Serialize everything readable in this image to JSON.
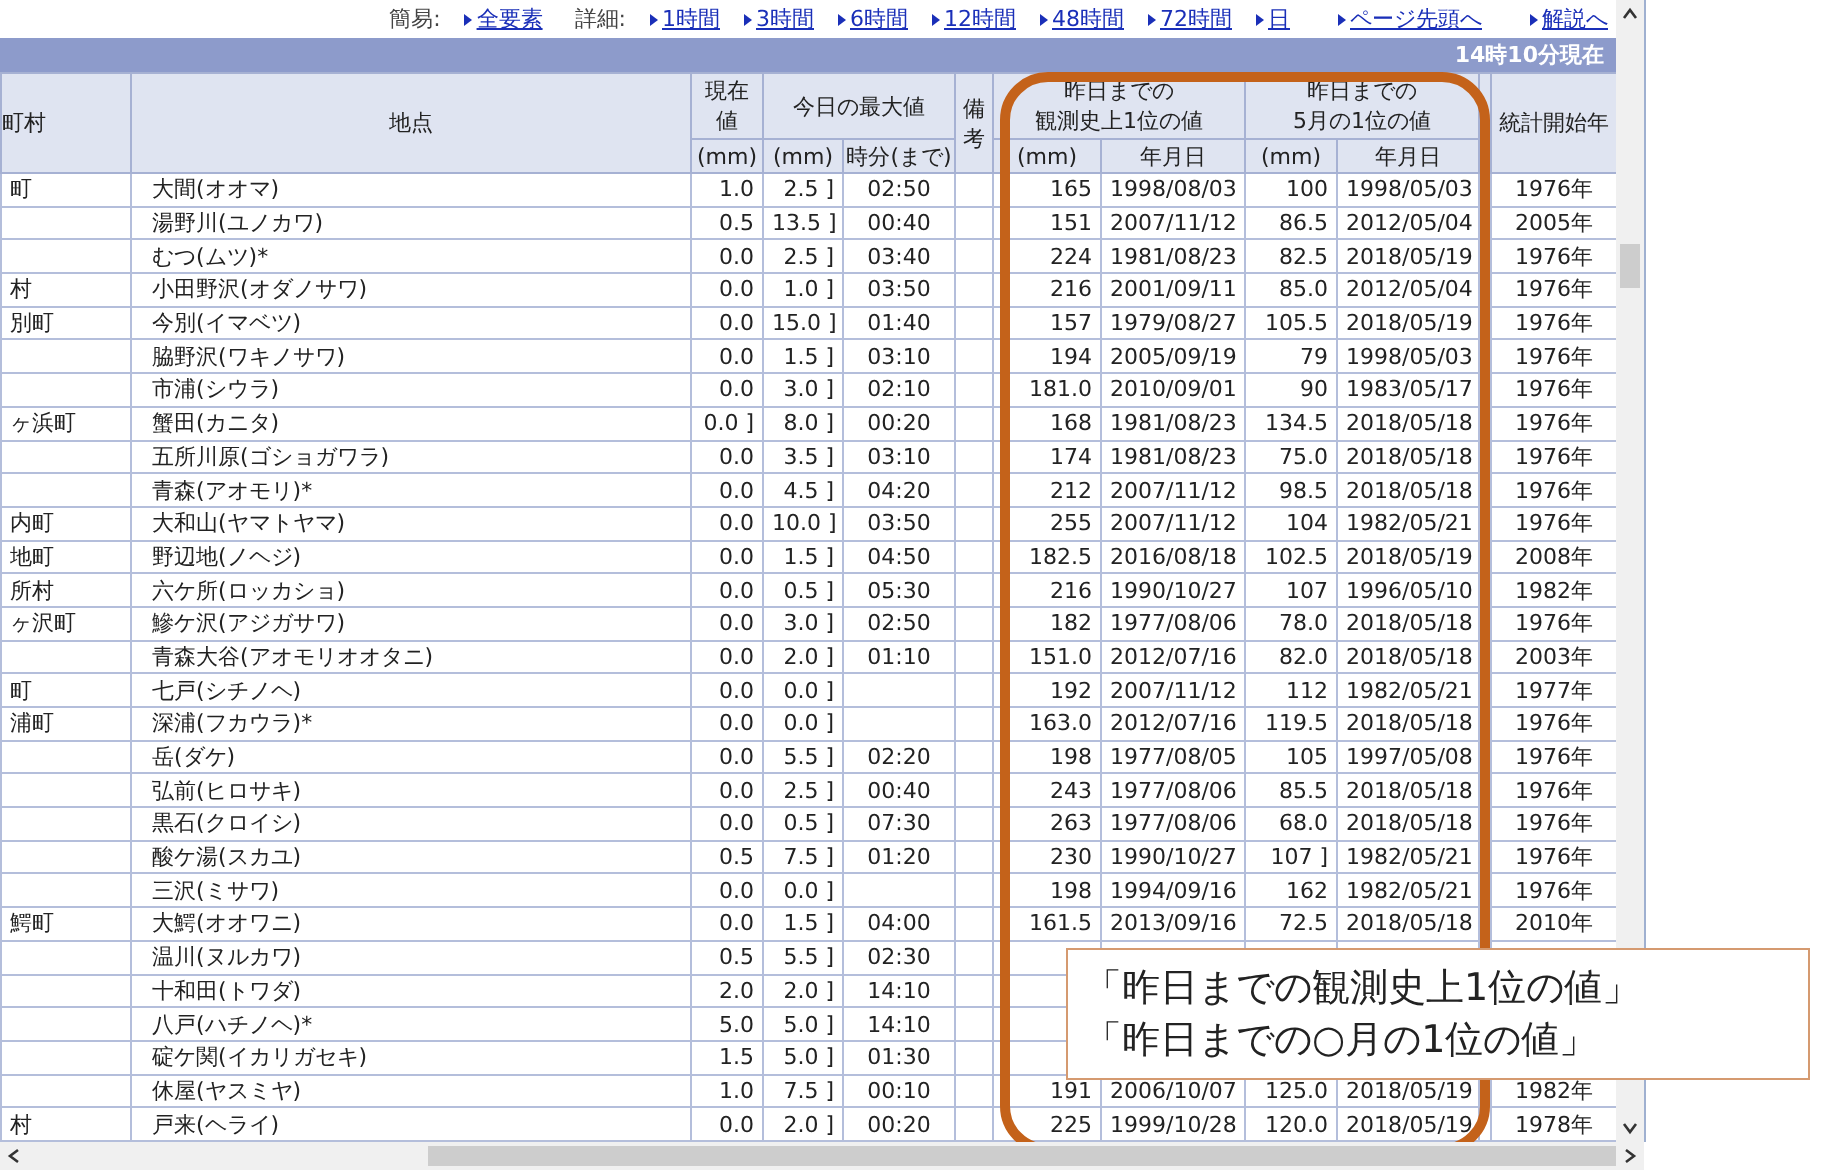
{
  "nav": {
    "simple_label": "簡易:",
    "simple_links": [
      "全要素"
    ],
    "detail_label": "詳細:",
    "detail_links": [
      "1時間",
      "3時間",
      "6時間",
      "12時間",
      "48時間",
      "72時間",
      "日"
    ],
    "page_links": [
      "ページ先頭へ",
      "解説へ"
    ]
  },
  "title_bar": {
    "time": "14時10分現在"
  },
  "header": {
    "municipality": "町村",
    "station": "地点",
    "current": [
      "現在",
      "値"
    ],
    "current_unit": "(mm)",
    "today_max": "今日の最大値",
    "today_max_unit": "(mm)",
    "today_max_time": "時分(まで)",
    "remarks": "備考",
    "record": [
      "昨日までの",
      "観測史上1位の値"
    ],
    "record_unit": "(mm)",
    "record_date": "年月日",
    "month_record": [
      "昨日までの",
      "5月の1位の値"
    ],
    "month_record_unit": "(mm)",
    "month_record_date": "年月日",
    "start_year": "統計開始年"
  },
  "rows": [
    {
      "municipality": "町",
      "station": "大間(オオマ)",
      "current": "1.0",
      "max_mm": "2.5 ]",
      "max_time": "02:50",
      "record_mm": "165",
      "record_date": "1998/08/03",
      "month_mm": "100",
      "month_date": "1998/05/03",
      "start_year": "1976年"
    },
    {
      "station": "湯野川(ユノカワ)",
      "current": "0.5",
      "max_mm": "13.5 ]",
      "max_time": "00:40",
      "record_mm": "151",
      "record_date": "2007/11/12",
      "month_mm": "86.5",
      "month_date": "2012/05/04",
      "start_year": "2005年"
    },
    {
      "station": "むつ(ムツ)*",
      "current": "0.0",
      "max_mm": "2.5 ]",
      "max_time": "03:40",
      "record_mm": "224",
      "record_date": "1981/08/23",
      "month_mm": "82.5",
      "month_date": "2018/05/19",
      "start_year": "1976年"
    },
    {
      "municipality": "村",
      "station": "小田野沢(オダノサワ)",
      "current": "0.0",
      "max_mm": "1.0 ]",
      "max_time": "03:50",
      "record_mm": "216",
      "record_date": "2001/09/11",
      "month_mm": "85.0",
      "month_date": "2012/05/04",
      "start_year": "1976年"
    },
    {
      "municipality": "別町",
      "station": "今別(イマベツ)",
      "current": "0.0",
      "max_mm": "15.0 ]",
      "max_time": "01:40",
      "record_mm": "157",
      "record_date": "1979/08/27",
      "month_mm": "105.5",
      "month_date": "2018/05/19",
      "start_year": "1976年"
    },
    {
      "station": "脇野沢(ワキノサワ)",
      "current": "0.0",
      "max_mm": "1.5 ]",
      "max_time": "03:10",
      "record_mm": "194",
      "record_date": "2005/09/19",
      "month_mm": "79",
      "month_date": "1998/05/03",
      "start_year": "1976年"
    },
    {
      "station": "市浦(シウラ)",
      "current": "0.0",
      "max_mm": "3.0 ]",
      "max_time": "02:10",
      "record_mm": "181.0",
      "record_date": "2010/09/01",
      "month_mm": "90",
      "month_date": "1983/05/17",
      "start_year": "1976年"
    },
    {
      "municipality": "ヶ浜町",
      "station": "蟹田(カニタ)",
      "current": "0.0 ]",
      "max_mm": "8.0 ]",
      "max_time": "00:20",
      "record_mm": "168",
      "record_date": "1981/08/23",
      "month_mm": "134.5",
      "month_date": "2018/05/18",
      "start_year": "1976年"
    },
    {
      "station": "五所川原(ゴショガワラ)",
      "current": "0.0",
      "max_mm": "3.5 ]",
      "max_time": "03:10",
      "record_mm": "174",
      "record_date": "1981/08/23",
      "month_mm": "75.0",
      "month_date": "2018/05/18",
      "start_year": "1976年"
    },
    {
      "station": "青森(アオモリ)*",
      "current": "0.0",
      "max_mm": "4.5 ]",
      "max_time": "04:20",
      "record_mm": "212",
      "record_date": "2007/11/12",
      "month_mm": "98.5",
      "month_date": "2018/05/18",
      "start_year": "1976年"
    },
    {
      "municipality": "内町",
      "station": "大和山(ヤマトヤマ)",
      "current": "0.0",
      "max_mm": "10.0 ]",
      "max_time": "03:50",
      "record_mm": "255",
      "record_date": "2007/11/12",
      "month_mm": "104",
      "month_date": "1982/05/21",
      "start_year": "1976年"
    },
    {
      "municipality": "地町",
      "station": "野辺地(ノヘジ)",
      "current": "0.0",
      "max_mm": "1.5 ]",
      "max_time": "04:50",
      "record_mm": "182.5",
      "record_date": "2016/08/18",
      "month_mm": "102.5",
      "month_date": "2018/05/19",
      "start_year": "2008年"
    },
    {
      "municipality": "所村",
      "station": "六ケ所(ロッカショ)",
      "current": "0.0",
      "max_mm": "0.5 ]",
      "max_time": "05:30",
      "record_mm": "216",
      "record_date": "1990/10/27",
      "month_mm": "107",
      "month_date": "1996/05/10",
      "start_year": "1982年"
    },
    {
      "municipality": "ヶ沢町",
      "station": "鰺ケ沢(アジガサワ)",
      "current": "0.0",
      "max_mm": "3.0 ]",
      "max_time": "02:50",
      "record_mm": "182",
      "record_date": "1977/08/06",
      "month_mm": "78.0",
      "month_date": "2018/05/18",
      "start_year": "1976年"
    },
    {
      "station": "青森大谷(アオモリオオタニ)",
      "current": "0.0",
      "max_mm": "2.0 ]",
      "max_time": "01:10",
      "record_mm": "151.0",
      "record_date": "2012/07/16",
      "month_mm": "82.0",
      "month_date": "2018/05/18",
      "start_year": "2003年"
    },
    {
      "municipality": "町",
      "station": "七戸(シチノヘ)",
      "current": "0.0",
      "max_mm": "0.0 ]",
      "record_mm": "192",
      "record_date": "2007/11/12",
      "month_mm": "112",
      "month_date": "1982/05/21",
      "start_year": "1977年"
    },
    {
      "municipality": "浦町",
      "station": "深浦(フカウラ)*",
      "current": "0.0",
      "max_mm": "0.0 ]",
      "record_mm": "163.0",
      "record_date": "2012/07/16",
      "month_mm": "119.5",
      "month_date": "2018/05/18",
      "start_year": "1976年"
    },
    {
      "station": "岳(ダケ)",
      "current": "0.0",
      "max_mm": "5.5 ]",
      "max_time": "02:20",
      "record_mm": "198",
      "record_date": "1977/08/05",
      "month_mm": "105",
      "month_date": "1997/05/08",
      "start_year": "1976年"
    },
    {
      "station": "弘前(ヒロサキ)",
      "current": "0.0",
      "max_mm": "2.5 ]",
      "max_time": "00:40",
      "record_mm": "243",
      "record_date": "1977/08/06",
      "month_mm": "85.5",
      "month_date": "2018/05/18",
      "start_year": "1976年"
    },
    {
      "station": "黒石(クロイシ)",
      "current": "0.0",
      "max_mm": "0.5 ]",
      "max_time": "07:30",
      "record_mm": "263",
      "record_date": "1977/08/06",
      "month_mm": "68.0",
      "month_date": "2018/05/18",
      "start_year": "1976年"
    },
    {
      "station": "酸ケ湯(スカユ)",
      "current": "0.5",
      "max_mm": "7.5 ]",
      "max_time": "01:20",
      "record_mm": "230",
      "record_date": "1990/10/27",
      "month_mm": "107 ]",
      "month_date": "1982/05/21",
      "start_year": "1976年"
    },
    {
      "station": "三沢(ミサワ)",
      "current": "0.0",
      "max_mm": "0.0 ]",
      "record_mm": "198",
      "record_date": "1994/09/16",
      "month_mm": "162",
      "month_date": "1982/05/21",
      "start_year": "1976年"
    },
    {
      "municipality": "鰐町",
      "station": "大鰐(オオワニ)",
      "current": "0.0",
      "max_mm": "1.5 ]",
      "max_time": "04:00",
      "record_mm": "161.5",
      "record_date": "2013/09/16",
      "month_mm": "72.5",
      "month_date": "2018/05/18",
      "start_year": "2010年"
    },
    {
      "station": "温川(ヌルカワ)",
      "current": "0.5",
      "max_mm": "5.5 ]",
      "max_time": "02:30"
    },
    {
      "station": "十和田(トワダ)",
      "current": "2.0",
      "max_mm": "2.0 ]",
      "max_time": "14:10"
    },
    {
      "station": "八戸(ハチノヘ)*",
      "current": "5.0",
      "max_mm": "5.0 ]",
      "max_time": "14:10"
    },
    {
      "station": "碇ケ関(イカリガセキ)",
      "current": "1.5",
      "max_mm": "5.0 ]",
      "max_time": "01:30"
    },
    {
      "station": "休屋(ヤスミヤ)",
      "current": "1.0",
      "max_mm": "7.5 ]",
      "max_time": "00:10",
      "record_mm": "191",
      "record_date": "2006/10/07",
      "month_mm": "125.0",
      "month_date": "2018/05/19",
      "start_year": "1982年"
    },
    {
      "municipality": "村",
      "station": "戸来(ヘライ)",
      "current": "0.0",
      "max_mm": "2.0 ]",
      "max_time": "00:20",
      "record_mm": "225",
      "record_date": "1999/10/28",
      "month_mm": "120.0",
      "month_date": "2018/05/19",
      "start_year": "1978年"
    }
  ],
  "callout": {
    "lines": [
      "「昨日までの観測史上1位の値」",
      "「昨日までの○月の1位の値」"
    ]
  }
}
